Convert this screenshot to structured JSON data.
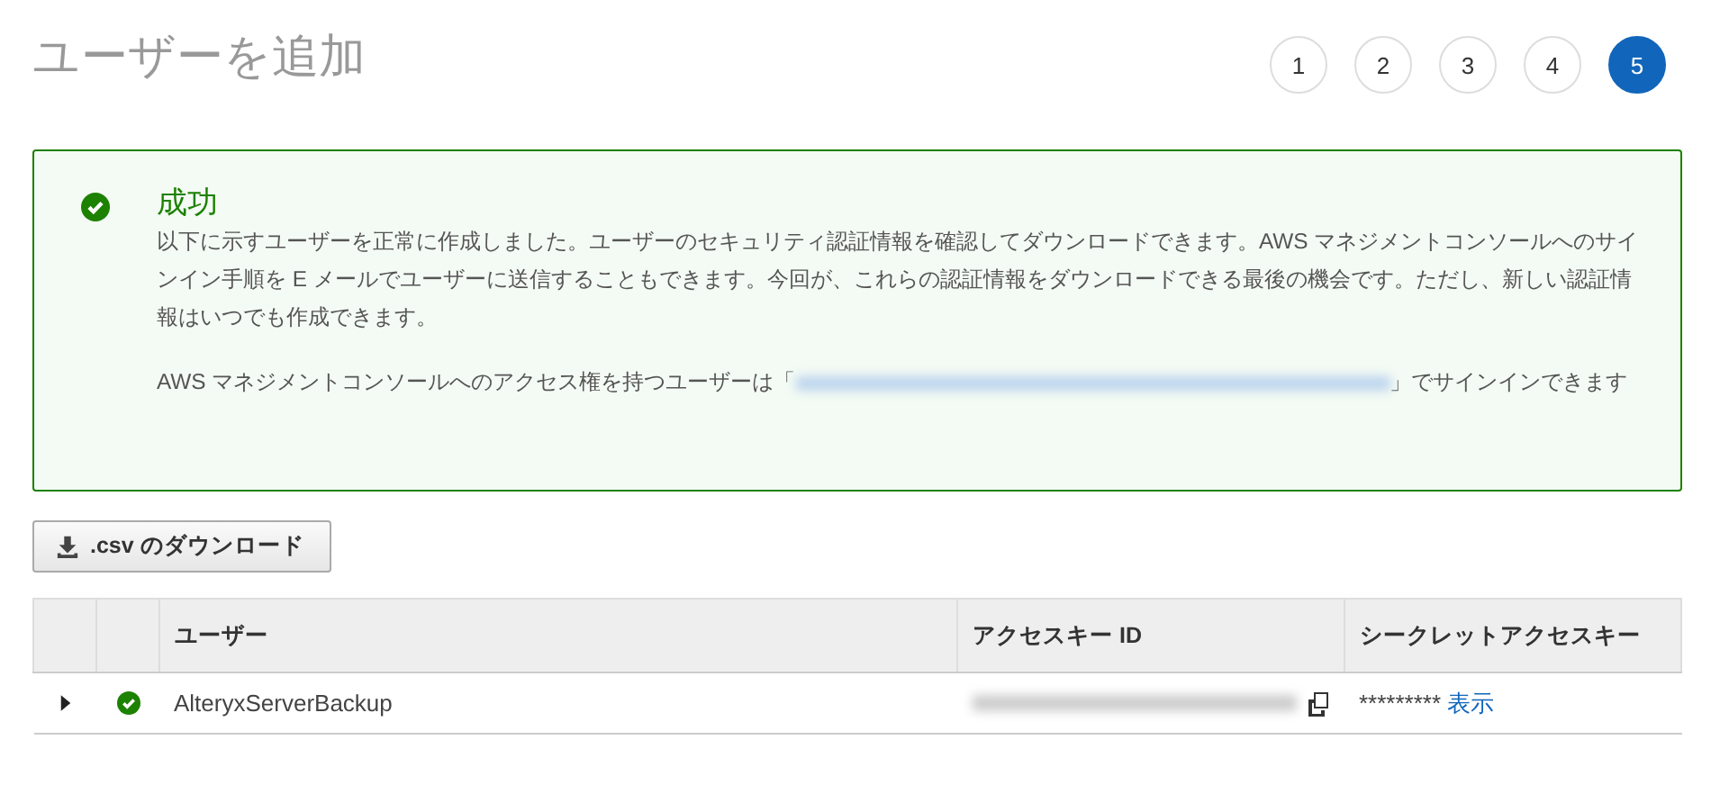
{
  "title": "ユーザーを追加",
  "steps": [
    {
      "label": "1",
      "selected": false
    },
    {
      "label": "2",
      "selected": false
    },
    {
      "label": "3",
      "selected": false
    },
    {
      "label": "4",
      "selected": false
    },
    {
      "label": "5",
      "selected": true
    }
  ],
  "alert": {
    "success": true,
    "heading": "成功",
    "message": "以下に示すユーザーを正常に作成しました。ユーザーのセキュリティ認証情報を確認してダウンロードできます。AWS マネジメントコンソールへのサインイン手順を E メールでユーザーに送信することもできます。今回が、これらの認証情報をダウンロードできる最後の機会です。ただし、新しい認証情報はいつでも作成できます。",
    "signin_before": "AWS マネジメントコンソールへのアクセス権を持つユーザーは「",
    "signin_after": "」でサインインできます"
  },
  "download_button": ".csv のダウンロード",
  "table": {
    "columns": [
      "ユーザー",
      "アクセスキー ID",
      "シークレットアクセスキー"
    ],
    "rows": [
      {
        "expanded": false,
        "success": true,
        "user": "AlteryxServerBackup",
        "secret": "*********",
        "show_link": "表示"
      }
    ]
  }
}
